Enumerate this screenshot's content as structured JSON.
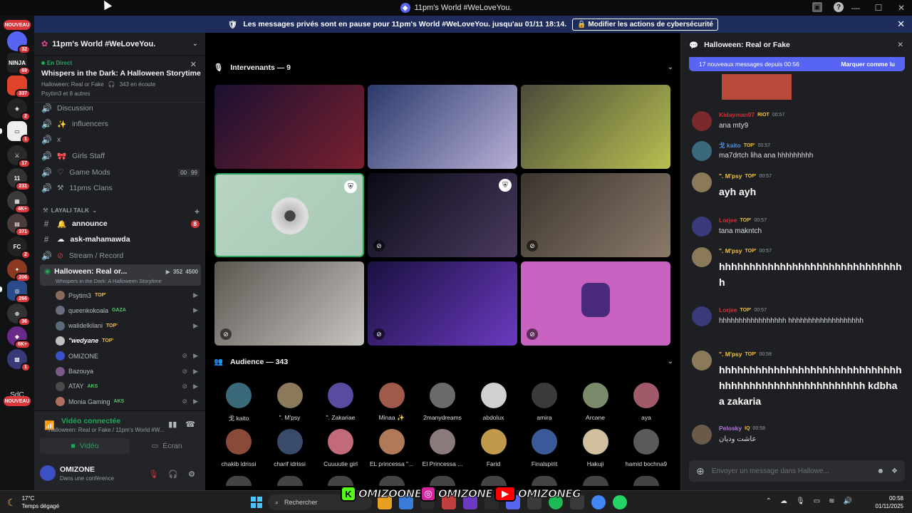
{
  "window": {
    "title": "11pm's World #WeLoveYou.",
    "controls": [
      "—",
      "☐",
      "✕"
    ]
  },
  "notice": {
    "text": "Les messages privés sont en pause pour 11pm's World #WeLoveYou. jusqu'au 01/11 18:14.",
    "button": "Modifier les actions de cybersécurité"
  },
  "rail": {
    "new_label": "NOUVEAU",
    "badges": [
      "32",
      "69",
      "337",
      "2",
      "1",
      "17",
      "231",
      "4K+",
      "371",
      "2",
      "206",
      "266",
      "36",
      "6K+",
      "1",
      "2"
    ],
    "sdc": "SdC"
  },
  "sidebar": {
    "server_name": "11pm's World #WeLoveYou.",
    "live_label": "En Direct",
    "stage_title": "Whispers in the Dark: A Halloween Storytime",
    "stage_channel": "Halloween: Real or Fake",
    "listeners": "343 en écoute",
    "speakers": "Psytim3 et 8 autres",
    "channels": [
      {
        "name": "Discussion",
        "icon": "🔇"
      },
      {
        "name": "influencers",
        "icon": "✨"
      },
      {
        "name": "x",
        "icon": ""
      },
      {
        "name": "Girls Staff",
        "icon": "🎀"
      },
      {
        "name": "Game Mods",
        "icon": "♡",
        "count_a": "00",
        "count_b": "99"
      },
      {
        "name": "11pms Clans",
        "icon": "⚒"
      }
    ],
    "category": "LAYALI TALK",
    "text_channels": [
      {
        "name": "announce",
        "badge": "8"
      },
      {
        "name": "ask-mahamawda"
      },
      {
        "name": "Stream / Record"
      }
    ],
    "active_channel": {
      "name": "Halloween: Real or...",
      "sub": "Whispers in the Dark: A Halloween Storytime",
      "count_a": "352",
      "count_b": "4500"
    },
    "voice_users": [
      {
        "name": "Psytim3",
        "tag": "TOP'",
        "color": "#8a6a5a"
      },
      {
        "name": "queenkokoala",
        "tag": "GAZA",
        "color": "#6a6a80"
      },
      {
        "name": "walidelkilani",
        "tag": "TOP'",
        "color": "#5a6a7a"
      },
      {
        "name": "\"wedyane",
        "tag": "TOP'",
        "color": "#c0c0c0"
      },
      {
        "name": "OMIZONE",
        "tag": "",
        "color": "#3c4fc4"
      },
      {
        "name": "Bazouya",
        "tag": "",
        "color": "#7a5a8a"
      },
      {
        "name": "ATAY",
        "tag": "AKS",
        "color": "#4a4a4a"
      },
      {
        "name": "Monia Gaming",
        "tag": "AKS",
        "color": "#b07060"
      }
    ],
    "voice_panel": {
      "status": "Vidéo connectée",
      "sub": "Halloween: Real or Fake / 11pm's World #W...",
      "video": "Vidéo",
      "screen": "Écran"
    },
    "user": {
      "name": "OMIZONE",
      "status": "Dans une conférence"
    }
  },
  "stage": {
    "speakers_label": "Intervenants — 9",
    "audience_label": "Audience — 343",
    "tiles": [
      {
        "colors": [
          "#1a1030",
          "#7a2030"
        ]
      },
      {
        "colors": [
          "#2a3a6a",
          "#b8b0d8"
        ]
      },
      {
        "colors": [
          "#4a4a3a",
          "#b8c050"
        ]
      },
      {
        "colors": [
          "#b8d4c2",
          "#a8c8b6"
        ]
      },
      {
        "colors": [
          "#0a0a14",
          "#4a3a60"
        ]
      },
      {
        "colors": [
          "#3a342e",
          "#8a7a6a"
        ]
      },
      {
        "colors": [
          "#5a5650",
          "#c8c4c0"
        ]
      },
      {
        "colors": [
          "#1a1040",
          "#6a3ac0"
        ]
      },
      {
        "colors": [
          "#c862c0",
          "#c862c0"
        ]
      }
    ],
    "audience": [
      {
        "name": "戈 kaito",
        "color": "#3a6a7a"
      },
      {
        "name": "\". M'psy",
        "color": "#8a7a5a"
      },
      {
        "name": "\". Zakariae",
        "color": "#5a4aa0"
      },
      {
        "name": "Minaa ✨",
        "color": "#a05a4a"
      },
      {
        "name": "2manydreams",
        "color": "#6a6a6a"
      },
      {
        "name": "abdolux",
        "color": "#d0d0d0"
      },
      {
        "name": "amira",
        "color": "#3a3a3a"
      },
      {
        "name": "Arcane",
        "color": "#7a8a6a"
      },
      {
        "name": "aya",
        "color": "#a05a6a"
      },
      {
        "name": "chakib idrissi",
        "color": "#8a4a3a"
      },
      {
        "name": "charif idrissi",
        "color": "#3a4a6a"
      },
      {
        "name": "Cuuuutie girl",
        "color": "#c06a7a"
      },
      {
        "name": "EL princessa \"...",
        "color": "#b07a5a"
      },
      {
        "name": "El Princessa ...",
        "color": "#8a7a7a"
      },
      {
        "name": "Farid",
        "color": "#c09a4a"
      },
      {
        "name": "Finalspirit",
        "color": "#3a5a9a"
      },
      {
        "name": "Hakuji",
        "color": "#d0c0a0"
      },
      {
        "name": "hamid bochna9",
        "color": "#5a5a5a"
      }
    ]
  },
  "chat": {
    "title": "Halloween: Real or Fake",
    "new_messages": "17 nouveaux messages depuis 00:56",
    "mark_read": "Marquer comme lu",
    "messages": [
      {
        "name": "Kidayman97",
        "tag": "RIOT",
        "time": "00:57",
        "body": "ana mty9",
        "big": false,
        "color": "#c8343a",
        "avatar": "#7a2a2a"
      },
      {
        "name": "戈 kaito",
        "tag": "TOP'",
        "time": "00:57",
        "body": "ma7drtch liha ana hhhhhhhhh",
        "big": false,
        "color": "#5a8ad8",
        "avatar": "#3a6a7a"
      },
      {
        "name": "\". M'psy",
        "tag": "TOP'",
        "time": "00:57",
        "body": "ayh ayh",
        "big": true,
        "color": "#f0c040",
        "avatar": "#8a7a5a"
      },
      {
        "name": "Lorjee",
        "tag": "TOP'",
        "time": "00:57",
        "body": "tana makntch",
        "big": false,
        "color": "#c8343a",
        "avatar": "#3a3a7a"
      },
      {
        "name": "\". M'psy",
        "tag": "TOP'",
        "time": "00:57",
        "body": "hhhhhhhhhhhhhhhhhhhhhhhhhhhhhhh",
        "big": true,
        "color": "#f0c040",
        "avatar": "#8a7a5a"
      },
      {
        "name": "Lorjee",
        "tag": "TOP'",
        "time": "00:57",
        "body": "hhhhhhhhhhhhhhhhh hhhhhhhhhhhhhhhhhhh",
        "big": false,
        "color": "#c8343a",
        "avatar": "#3a3a7a"
      },
      {
        "name": "\". M'psy",
        "tag": "TOP'",
        "time": "00:58",
        "body": "hhhhhhhhhhhhhhhhhhhhhhhhhhhhhhhhhhhhhhhhhhhhhhhhhhhhhh kdbha a zakaria",
        "big": true,
        "color": "#f0c040",
        "avatar": "#8a7a5a"
      },
      {
        "name": "Pelosky",
        "tag": "IQ",
        "time": "00:58",
        "body": "عاشت وديان",
        "big": false,
        "color": "#b07ad8",
        "avatar": "#6a5a4a"
      }
    ],
    "placeholder": "Envoyer un message dans  Hallowe..."
  },
  "taskbar": {
    "temp": "17°C",
    "weather": "Temps dégagé",
    "search": "Rechercher",
    "time": "00:58",
    "date": "01/11/2025"
  },
  "watermark": [
    "OMIZOONE",
    "OMIZONE",
    "OMIZONEG"
  ]
}
